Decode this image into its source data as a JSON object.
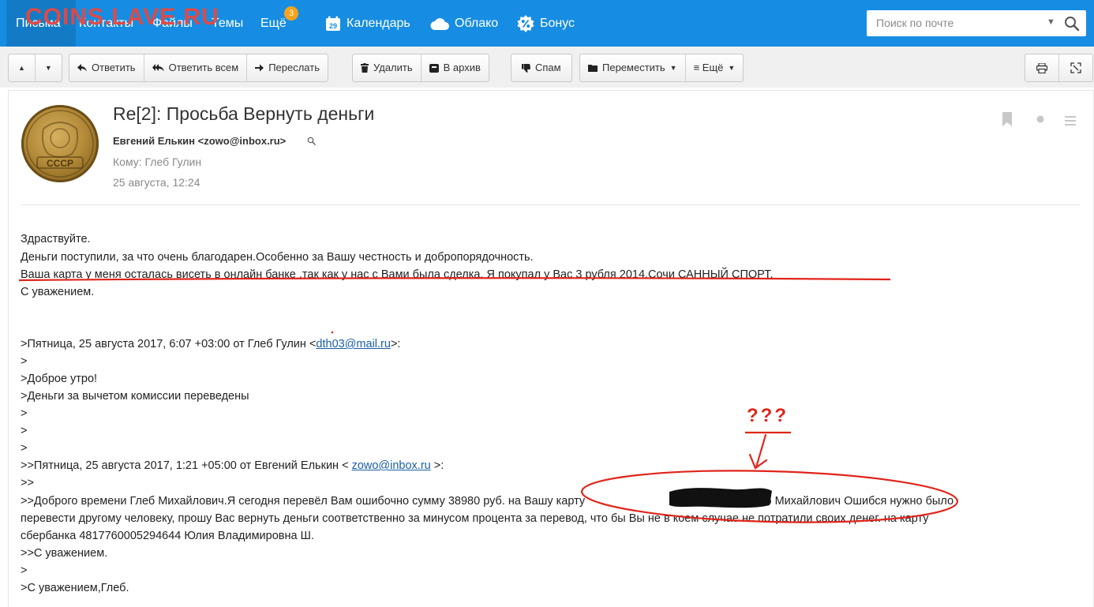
{
  "topbar": {
    "watermark": "COINS.LAVE.RU",
    "nav": {
      "letters": "Письма",
      "contacts": "Контакты",
      "files": "Файлы",
      "topics": "Темы",
      "more": "Ещё",
      "more_badge": "3"
    },
    "services": {
      "calendar": "Календарь",
      "calendar_day": "29",
      "cloud": "Облако",
      "bonus": "Бонус"
    },
    "search_placeholder": "Поиск по почте"
  },
  "toolbar": {
    "reply": "Ответить",
    "reply_all": "Ответить всем",
    "forward": "Переслать",
    "delete": "Удалить",
    "archive": "В архив",
    "spam": "Спам",
    "move": "Переместить",
    "more": "≡ Ещё"
  },
  "message": {
    "subject": "Re[2]: Просьба Вернуть деньги",
    "sender": "Евгений Елькин <zowo@inbox.ru>",
    "to": "Кому: Глеб Гулин",
    "date": "25 августа, 12:24",
    "avatar_text": "СССР",
    "body": [
      "Здраствуйте.",
      "Деньги поступили, за что очень благодарен.Особенно за Вашу честность и добропорядочность.",
      "Ваша карта у меня осталась висеть в онлайн банке ,так как у нас с Вами была сделка. Я покупал у Вас  3 рубля 2014.Сочи САННЫЙ СПОРТ.",
      "С уважением."
    ],
    "quote1": {
      "header_prefix": ">Пятница, 25 августа 2017, 6:07 +03:00 от Глеб Гулин <",
      "email": "dth03@mail.ru",
      "header_suffix": ">:",
      "lines": [
        ">",
        ">Доброе утро!",
        ">Деньги за вычетом комиссии переведены",
        ">",
        ">",
        ">"
      ]
    },
    "quote2": {
      "header_prefix": ">>Пятница, 25 августа 2017, 1:21 +05:00 от Евгений Елькин < ",
      "email": "zowo@inbox.ru",
      "header_suffix": " >:",
      "line_gt": ">>",
      "p1": ">>Доброго времени  Глеб Михайлович.Я сегодня перевёл Вам ошибочно сумму 38980 руб. на Вашу карту",
      "p1_end": "1242 Гулин Глеб Михайлович Ошибся нужно было",
      "p2": "перевести другому человеку, прошу Вас вернуть деньги соответственно за минусом процента за перевод, что бы Вы не в коем случае не потратили своих денег. на карту",
      "p3": "сбербанка 4817760005294644 Юлия Владимировна Ш.",
      "closing": ">>С уважением.",
      "gt": ">",
      "final": ">С уважением,Глеб."
    }
  },
  "annotation": {
    "question_marks": "???",
    "color": "#e0251b"
  },
  "colors": {
    "topbar": "#168de2",
    "toolbar_bg": "#f0f0f0",
    "link": "#1a5fa8"
  }
}
